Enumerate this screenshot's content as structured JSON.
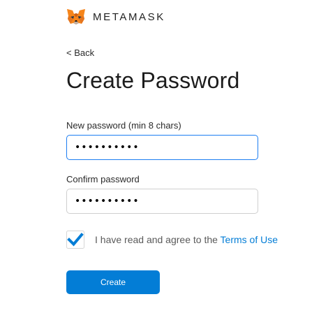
{
  "header": {
    "wordmark": "METAMASK",
    "logo_icon": "metamask-fox-icon"
  },
  "nav": {
    "back_label": "< Back"
  },
  "form": {
    "title": "Create Password",
    "new_password": {
      "label": "New password (min 8 chars)",
      "value": "••••••••••"
    },
    "confirm_password": {
      "label": "Confirm password",
      "value": "••••••••••"
    },
    "agreement": {
      "checked": true,
      "text": "I have read and agree to the ",
      "link_text": "Terms of Use"
    },
    "submit_label": "Create"
  },
  "colors": {
    "accent": "#037dd6",
    "focus_border": "#1c7df2",
    "fox_orange": "#e2761b"
  }
}
